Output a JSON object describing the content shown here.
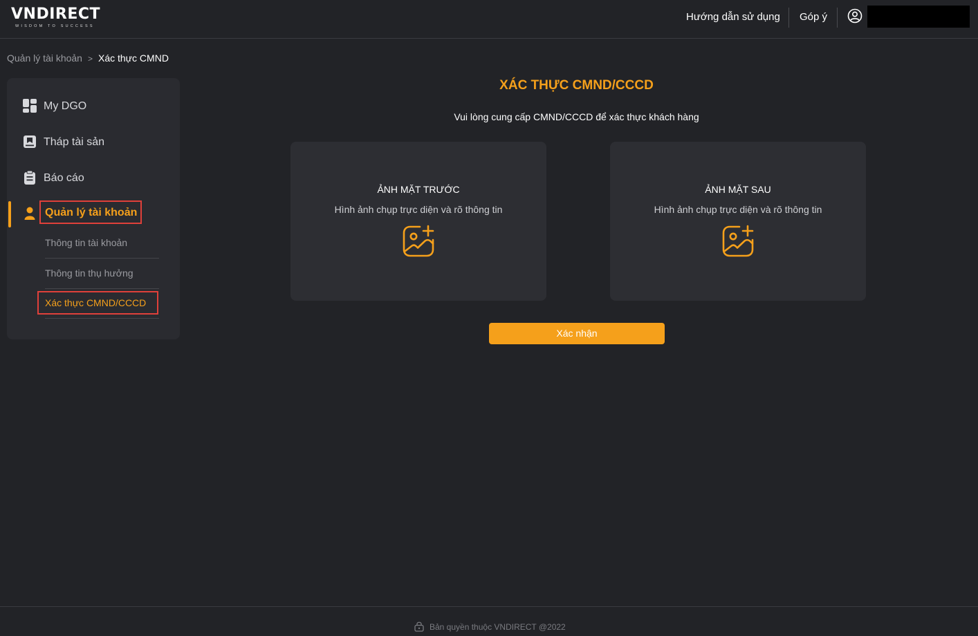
{
  "header": {
    "logo_text": "VNDIRECT",
    "logo_tagline": "WISDOM TO SUCCESS",
    "guide_label": "Hướng dẫn sử dụng",
    "feedback_label": "Góp ý",
    "user_icon": "user-circle-icon"
  },
  "breadcrumb": {
    "parent": "Quản lý tài khoản",
    "separator": ">",
    "current": "Xác thực CMND"
  },
  "sidebar": {
    "items": [
      {
        "label": "My DGO",
        "icon": "grid-icon"
      },
      {
        "label": "Tháp tài sản",
        "icon": "asset-tower-icon"
      },
      {
        "label": "Báo cáo",
        "icon": "clipboard-icon"
      },
      {
        "label": "Quản lý tài khoản",
        "icon": "user-icon",
        "active": true
      }
    ],
    "subitems": [
      {
        "label": "Thông tin tài khoản"
      },
      {
        "label": "Thông tin thụ hưởng"
      },
      {
        "label": "Xác thực CMND/CCCD",
        "active": true
      }
    ]
  },
  "main": {
    "title": "XÁC THỰC CMND/CCCD",
    "subtitle": "Vui lòng cung cấp CMND/CCCD để xác thực khách hàng",
    "cards": [
      {
        "title": "ẢNH MẶT TRƯỚC",
        "desc": "Hình ảnh chụp trực diện và rõ thông tin",
        "icon": "add-image-icon"
      },
      {
        "title": "ẢNH MẶT SAU",
        "desc": "Hình ảnh chụp trực diện và rõ thông tin",
        "icon": "add-image-icon"
      }
    ],
    "confirm_label": "Xác nhận"
  },
  "footer": {
    "copyright": "Bản quyền thuộc VNDIRECT @2022",
    "icon": "lock-icon"
  },
  "colors": {
    "accent": "#f5a01b",
    "background": "#222327",
    "panel": "#2a2b30",
    "highlight_border": "#e0403a"
  }
}
